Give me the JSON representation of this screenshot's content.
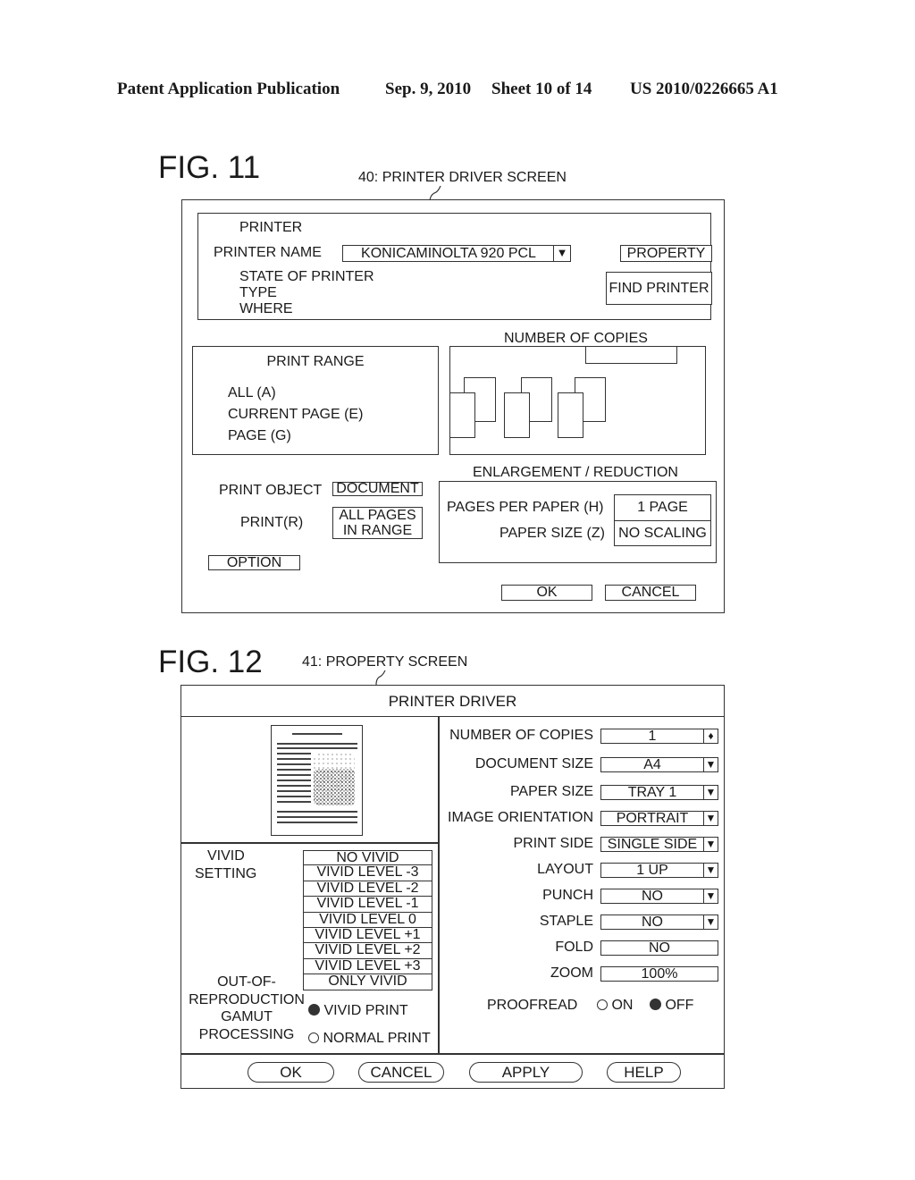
{
  "header": {
    "publication": "Patent Application Publication",
    "date": "Sep. 9, 2010",
    "sheet": "Sheet 10 of 14",
    "number": "US 2010/0226665 A1"
  },
  "fig11": {
    "label": "FIG. 11",
    "reference": "40: PRINTER DRIVER SCREEN",
    "printer": {
      "title": "PRINTER",
      "name_label": "PRINTER NAME",
      "name_value": "KONICAMINOLTA 920 PCL",
      "property_button": "PROPERTY",
      "find_button": "FIND PRINTER",
      "state_label": "STATE OF PRINTER",
      "type_label": "TYPE",
      "where_label": "WHERE"
    },
    "print_range": {
      "title": "PRINT RANGE",
      "options": [
        "ALL (A)",
        "CURRENT PAGE (E)",
        "PAGE (G)"
      ]
    },
    "copies": {
      "title": "NUMBER OF COPIES"
    },
    "print_object": {
      "label": "PRINT OBJECT",
      "value": "DOCUMENT"
    },
    "print_r": {
      "label": "PRINT(R)",
      "value_line1": "ALL PAGES",
      "value_line2": "IN RANGE"
    },
    "option_button": "OPTION",
    "enlargement": {
      "title": "ENLARGEMENT / REDUCTION",
      "pages_per_paper_label": "PAGES PER PAPER (H)",
      "pages_per_paper_value": "1 PAGE",
      "paper_size_label": "PAPER SIZE (Z)",
      "paper_size_value": "NO SCALING"
    },
    "ok_button": "OK",
    "cancel_button": "CANCEL"
  },
  "fig12": {
    "label": "FIG. 12",
    "reference": "41: PROPERTY SCREEN",
    "title": "PRINTER DRIVER",
    "vivid": {
      "label_line1": "VIVID",
      "label_line2": "SETTING",
      "options": [
        "NO VIVID",
        "VIVID LEVEL -3",
        "VIVID LEVEL -2",
        "VIVID LEVEL -1",
        "VIVID LEVEL 0",
        "VIVID LEVEL +1",
        "VIVID LEVEL +2",
        "VIVID LEVEL +3",
        "ONLY VIVID"
      ]
    },
    "gamut": {
      "label_line1": "OUT-OF-",
      "label_line2": "REPRODUCTION",
      "label_line3": "GAMUT",
      "label_line4": "PROCESSING",
      "option_vivid": "VIVID PRINT",
      "option_normal": "NORMAL PRINT",
      "selected": "VIVID PRINT"
    },
    "settings": [
      {
        "label": "NUMBER OF COPIES",
        "value": "1",
        "control": "spinner",
        "icon": "spinner-icon",
        "glyph": "♦"
      },
      {
        "label": "DOCUMENT SIZE",
        "value": "A4",
        "control": "dropdown",
        "icon": "dropdown-arrow-icon",
        "glyph": "▼"
      },
      {
        "label": "PAPER SIZE",
        "value": "TRAY 1",
        "control": "dropdown",
        "icon": "dropdown-arrow-icon",
        "glyph": "▼"
      },
      {
        "label": "IMAGE ORIENTATION",
        "value": "PORTRAIT",
        "control": "dropdown",
        "icon": "dropdown-arrow-icon",
        "glyph": "▼"
      },
      {
        "label": "PRINT SIDE",
        "value": "SINGLE SIDE",
        "control": "dropdown",
        "icon": "dropdown-arrow-icon",
        "glyph": "▼"
      },
      {
        "label": "LAYOUT",
        "value": "1 UP",
        "control": "dropdown",
        "icon": "dropdown-arrow-icon",
        "glyph": "▼"
      },
      {
        "label": "PUNCH",
        "value": "NO",
        "control": "dropdown",
        "icon": "dropdown-arrow-icon",
        "glyph": "▼"
      },
      {
        "label": "STAPLE",
        "value": "NO",
        "control": "dropdown",
        "icon": "dropdown-arrow-icon",
        "glyph": "▼"
      },
      {
        "label": "FOLD",
        "value": "NO",
        "control": "field"
      },
      {
        "label": "ZOOM",
        "value": "100%",
        "control": "field"
      }
    ],
    "proofread": {
      "label": "PROOFREAD",
      "on": "ON",
      "off": "OFF",
      "selected": "OFF"
    },
    "buttons": {
      "ok": "OK",
      "cancel": "CANCEL",
      "apply": "APPLY",
      "help": "HELP"
    }
  },
  "icons": {
    "dropdown": "▼",
    "spinner": "♦"
  }
}
